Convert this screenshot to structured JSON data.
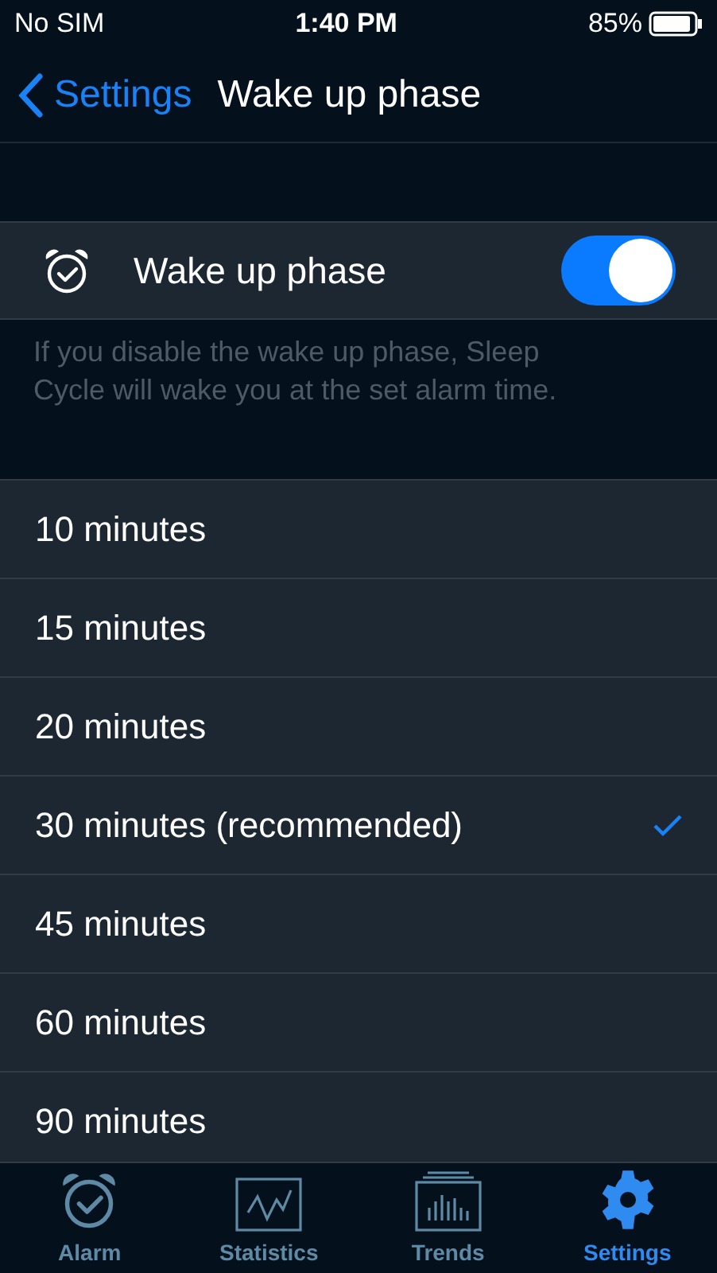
{
  "status_bar": {
    "carrier": "No SIM",
    "time": "1:40 PM",
    "battery": "85%"
  },
  "nav": {
    "back": "Settings",
    "title": "Wake up phase"
  },
  "toggle": {
    "label": "Wake up phase",
    "on": true
  },
  "description": "If you disable the wake up phase, Sleep Cycle will wake you at the set alarm time.",
  "options": [
    {
      "label": "10 minutes",
      "selected": false
    },
    {
      "label": "15 minutes",
      "selected": false
    },
    {
      "label": "20 minutes",
      "selected": false
    },
    {
      "label": "30 minutes (recommended)",
      "selected": true
    },
    {
      "label": "45 minutes",
      "selected": false
    },
    {
      "label": "60 minutes",
      "selected": false
    },
    {
      "label": "90 minutes",
      "selected": false
    }
  ],
  "tabs": [
    {
      "label": "Alarm",
      "kind": "alarm",
      "selected": false
    },
    {
      "label": "Statistics",
      "kind": "statistics",
      "selected": false
    },
    {
      "label": "Trends",
      "kind": "trends",
      "selected": false
    },
    {
      "label": "Settings",
      "kind": "settings",
      "selected": true
    }
  ]
}
